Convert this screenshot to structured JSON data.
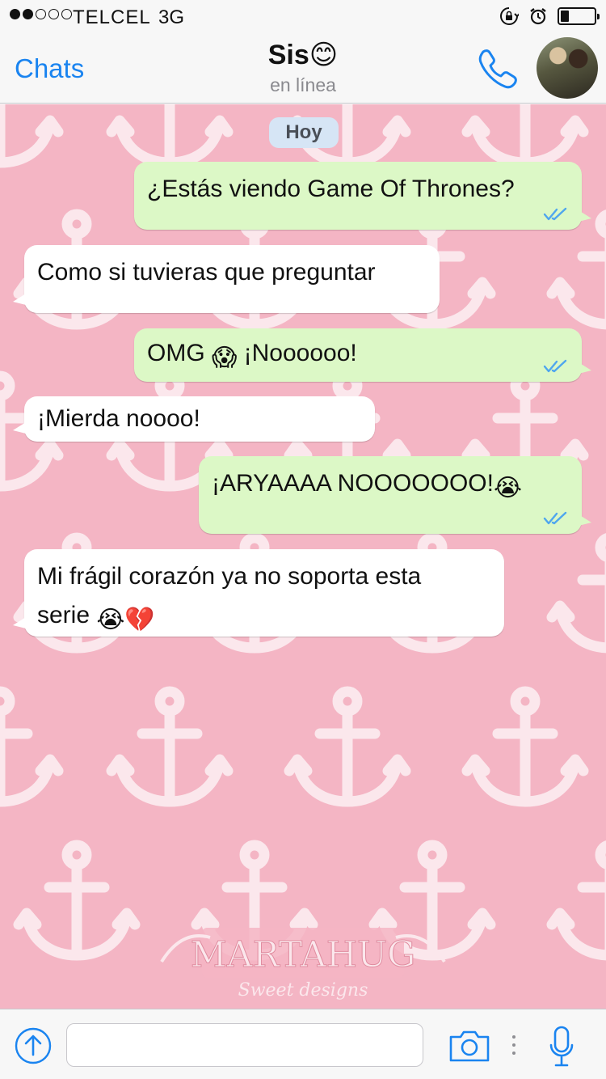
{
  "status_bar": {
    "signal_strength": "2 of 5",
    "carrier": "TELCEL",
    "network": "3G",
    "icons": [
      "rotation-lock-icon",
      "alarm-icon"
    ],
    "battery_level": 0.25
  },
  "header": {
    "back_label": "Chats",
    "title": "Sis😊",
    "subtitle": "en línea",
    "call_icon": "phone-icon",
    "avatar": "contact-avatar"
  },
  "chat": {
    "day_label": "Hoy",
    "background": {
      "color": "#f4b5c4",
      "pattern": "anchor-icon"
    },
    "watermark": {
      "title": "MARTAHUG",
      "subtitle": "Sweet designs"
    },
    "messages": [
      {
        "direction": "outgoing",
        "text": "¿Estás viendo Game Of Thrones?",
        "status": "read"
      },
      {
        "direction": "incoming",
        "text": "Como si tuvieras que preguntar"
      },
      {
        "direction": "outgoing",
        "text_before": "OMG ",
        "emoji": "😱",
        "text_after": " ¡Noooooo!",
        "status": "read"
      },
      {
        "direction": "incoming",
        "text": "¡Mierda noooo!"
      },
      {
        "direction": "outgoing",
        "text": "¡ARYAAAA NOOOOOOO!",
        "emoji": "😭",
        "status": "read"
      },
      {
        "direction": "incoming",
        "line1": "Mi frágil corazón ya no soporta esta",
        "line2": "serie ",
        "emoji": "😭💔"
      }
    ]
  },
  "input_bar": {
    "attach_icon": "upload-arrow-icon",
    "placeholder": "",
    "camera_icon": "camera-icon",
    "mic_icon": "microphone-icon"
  },
  "colors": {
    "accent": "#1a84f0",
    "outgoing_bubble": "#dcf8c6",
    "incoming_bubble": "#ffffff",
    "read_ticks": "#4fa6ee",
    "day_pill": "#d6e5f5"
  }
}
